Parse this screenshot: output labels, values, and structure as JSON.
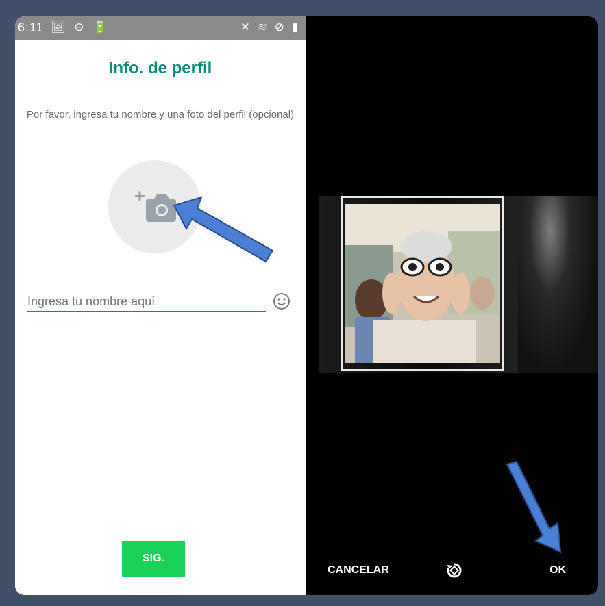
{
  "status_bar": {
    "time": "6:11",
    "left_icons": "🖼 ⊝ 🔋",
    "right_icons": "✕ ≋ ⊘ ▮"
  },
  "profile": {
    "title": "Info. de perfil",
    "description": "Por favor, ingresa tu nombre y una foto del perfil (opcional)",
    "name_placeholder": "Ingresa tu nombre aquí",
    "next_label": "SIG."
  },
  "crop": {
    "cancel_label": "CANCELAR",
    "ok_label": "OK"
  },
  "colors": {
    "accent": "#0d8a7a",
    "next_button": "#1bd15a",
    "arrow": "#4a7fd6",
    "frame": "#3f5068"
  },
  "icons": [
    "add-photo-icon",
    "emoji-icon",
    "rotate-icon",
    "arrow-pointer-icon"
  ]
}
